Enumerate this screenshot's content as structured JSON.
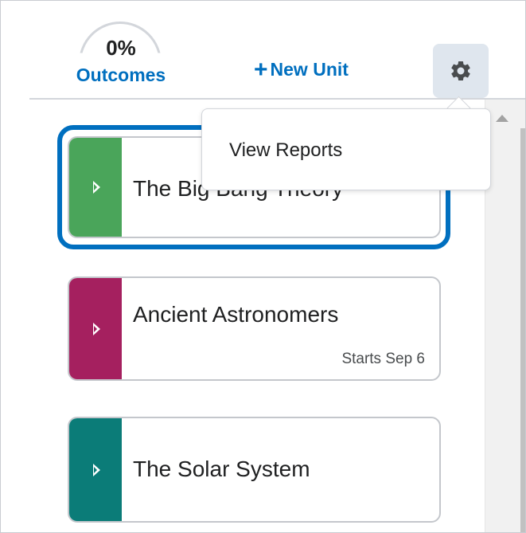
{
  "header": {
    "outcomes_percent": "0%",
    "outcomes_label": "Outcomes",
    "new_unit_plus": "+",
    "new_unit_label": "New Unit",
    "settings_icon": "gear-icon"
  },
  "menu": {
    "items": [
      {
        "label": "View Reports"
      }
    ]
  },
  "units": [
    {
      "title": "The Big Bang Theory",
      "color": "#4aa55a",
      "date": "",
      "selected": true
    },
    {
      "title": "Ancient Astronomers",
      "color": "#a5205f",
      "date": "Starts Sep 6",
      "selected": false
    },
    {
      "title": "The Solar System",
      "color": "#0b7c78",
      "date": "",
      "selected": false
    }
  ],
  "colors": {
    "accent": "#006fbf",
    "gear_button_bg": "#dfe6ee"
  }
}
